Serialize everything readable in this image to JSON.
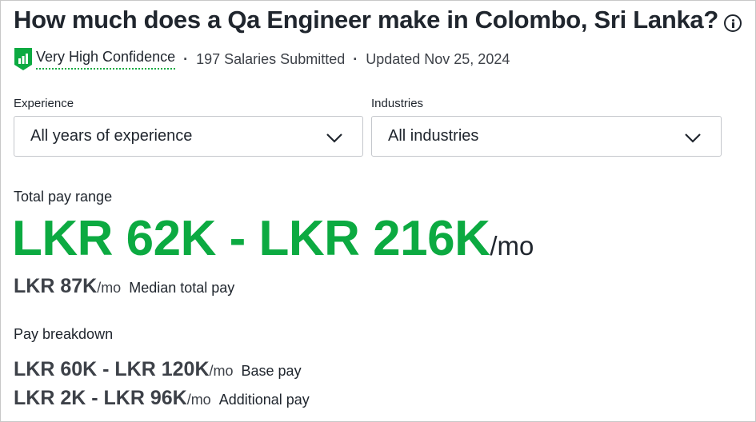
{
  "header": {
    "title": "How much does a Qa Engineer make in Colombo, Sri Lanka?",
    "confidence": "Very High Confidence",
    "salaries_submitted": "197 Salaries Submitted",
    "updated": "Updated Nov 25, 2024",
    "separator": "·"
  },
  "filters": {
    "experience_label": "Experience",
    "experience_value": "All years of experience",
    "industries_label": "Industries",
    "industries_value": "All industries"
  },
  "total_pay": {
    "label": "Total pay range",
    "range": "LKR 62K - LKR 216K",
    "unit": "/mo",
    "median_amount": "LKR 87K",
    "median_unit": "/mo",
    "median_label": "Median total pay"
  },
  "breakdown": {
    "label": "Pay breakdown",
    "base_amount": "LKR 60K - LKR 120K",
    "base_unit": "/mo",
    "base_label": "Base pay",
    "additional_amount": "LKR 2K - LKR 96K",
    "additional_unit": "/mo",
    "additional_label": "Additional pay"
  },
  "colors": {
    "accent": "#0caa41",
    "text": "#20262e"
  }
}
